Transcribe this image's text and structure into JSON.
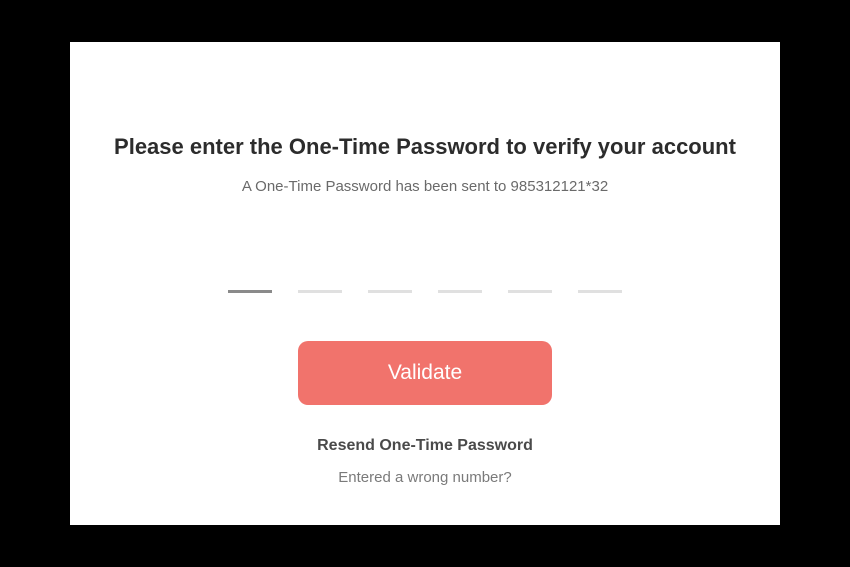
{
  "header": {
    "title": "Please enter the One-Time Password to verify your account",
    "subtitle": "A One-Time Password has been sent to 985312121*32"
  },
  "otp": {
    "digit_count": 6,
    "values": [
      "",
      "",
      "",
      "",
      "",
      ""
    ]
  },
  "actions": {
    "validate_label": "Validate",
    "resend_label": "Resend One-Time Password",
    "wrong_number_label": "Entered a wrong number?"
  }
}
